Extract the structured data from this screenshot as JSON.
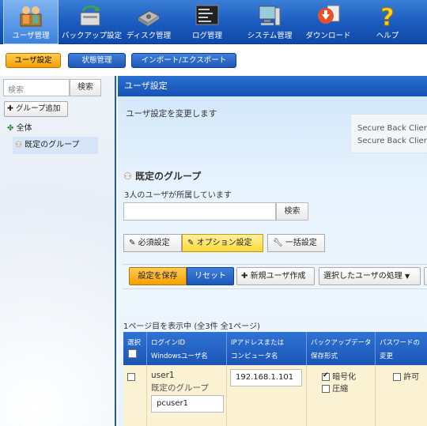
{
  "toolbar": {
    "items": [
      {
        "label": "ユーザ管理",
        "icon": "users-icon"
      },
      {
        "label": "バックアップ設定",
        "icon": "backup-icon"
      },
      {
        "label": "ディスク管理",
        "icon": "disk-icon"
      },
      {
        "label": "ログ管理",
        "icon": "log-icon"
      },
      {
        "label": "システム管理",
        "icon": "computer-icon"
      },
      {
        "label": "ダウンロード",
        "icon": "download-icon"
      },
      {
        "label": "ヘルプ",
        "icon": "help-icon"
      }
    ]
  },
  "subtabs": [
    "ユーザ設定",
    "状態管理",
    "インポート/エクスポート"
  ],
  "sidebar": {
    "search_placeholder": "検索",
    "search_button": "検索",
    "add_group": "グループ追加",
    "tree_all": "全体",
    "tree_group": "既定のグループ"
  },
  "main": {
    "header": "ユーザ設定",
    "description": "ユーザ設定を変更します",
    "client_lines": [
      "Secure Back Client",
      "Secure Back Client"
    ],
    "group_title": "既定のグループ",
    "group_sub": "3人のユーザが所属しています",
    "search_button": "検索",
    "tabs": [
      "必須設定",
      "オプション設定",
      "一括設定"
    ],
    "actions": {
      "save": "設定を保存",
      "reset": "リセット",
      "new_user": "新規ユーザ作成",
      "selected_users": "選択したユーザの処理"
    },
    "page_info": "1ページ目を表示中 (全3件 全1ページ)"
  },
  "table": {
    "headers": [
      {
        "line1": "選択",
        "line2": ""
      },
      {
        "line1": "ログインID",
        "line2": "Windowsユーザ名"
      },
      {
        "line1": "IPアドレスまたは",
        "line2": "コンピュータ名"
      },
      {
        "line1": "バックアップデータ",
        "line2": "保存形式"
      },
      {
        "line1": "パスワードの",
        "line2": "変更"
      }
    ],
    "rows": [
      {
        "login_id": "user1",
        "group": "既定のグループ",
        "windows_user": "pcuser1",
        "ip": "192.168.1.101",
        "encrypt_label": "暗号化",
        "encrypt_checked": true,
        "compress_label": "圧縮",
        "compress_checked": false,
        "password_label": "許可",
        "password_checked": false
      }
    ]
  },
  "colors": {
    "accent_blue": "#1752b5",
    "accent_orange": "#f5a000",
    "row_bg": "#fbf1d3"
  }
}
